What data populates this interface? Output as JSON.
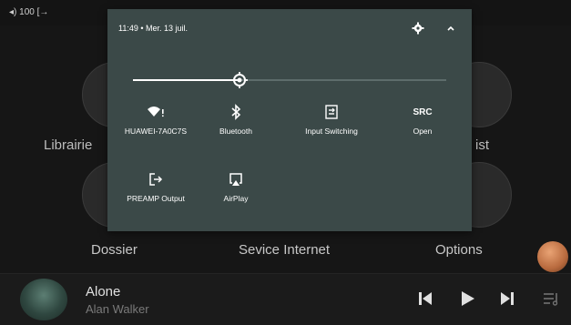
{
  "status_bar": {
    "volume": "100"
  },
  "home": {
    "tiles": [
      {
        "label": "Librairie"
      },
      {
        "label": "ist"
      }
    ],
    "row2": [
      {
        "label": "Dossier"
      },
      {
        "label": "Sevice Internet"
      },
      {
        "label": "Options"
      }
    ]
  },
  "now_playing": {
    "title": "Alone",
    "artist": "Alan Walker"
  },
  "quick_settings": {
    "time_date": "11:49 • Mer. 13 juil.",
    "brightness_level": 0.34,
    "tiles": [
      {
        "label": "HUAWEI-7A0C7S",
        "icon": "wifi-icon"
      },
      {
        "label": "Bluetooth",
        "icon": "bluetooth-icon"
      },
      {
        "label": "Input Switching",
        "icon": "input-switching-icon"
      },
      {
        "label": "Open",
        "icon_text": "SRC"
      },
      {
        "label": "PREAMP Output",
        "icon": "output-icon"
      },
      {
        "label": "AirPlay",
        "icon": "airplay-icon"
      }
    ]
  },
  "colors": {
    "panel": "#3b4948",
    "background": "#141414",
    "accent": "#c8794a"
  }
}
